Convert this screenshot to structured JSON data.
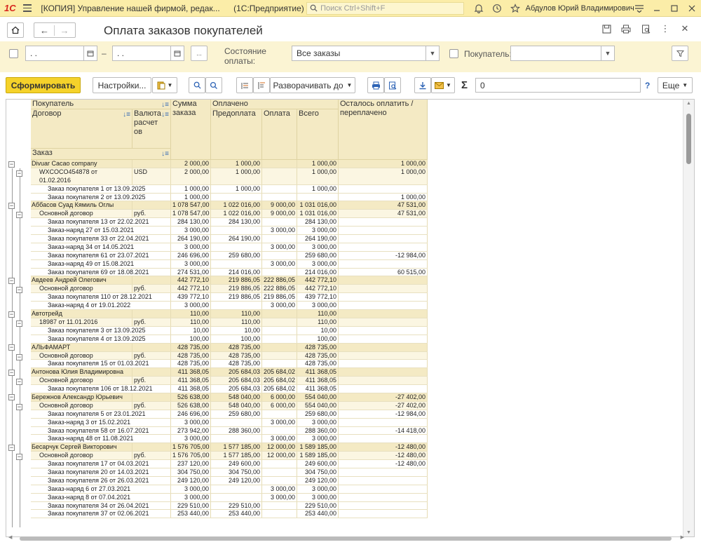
{
  "titlebar": {
    "logo": "1С",
    "app_title": "[КОПИЯ] Управление нашей фирмой, редак...",
    "platform": "(1С:Предприятие)",
    "search_placeholder": "Поиск Ctrl+Shift+F",
    "user": "Абдулов Юрий Владимирович"
  },
  "form": {
    "title": "Оплата заказов покупателей"
  },
  "filters": {
    "date_from": ". .",
    "date_to": ". .",
    "dash": "–",
    "period_btn": "...",
    "state_label": "Состояние оплаты:",
    "state_value": "Все заказы",
    "customer_label": "Покупатель:",
    "customer_value": ""
  },
  "commands": {
    "generate": "Сформировать",
    "settings": "Настройки...",
    "expand_to": "Разворачивать до",
    "sum_value": "0",
    "help": "?",
    "more": "Еще"
  },
  "table": {
    "headers": {
      "customer": "Покупатель",
      "contract": "Договор",
      "currency": "Валюта расчетов",
      "order": "Заказ",
      "order_sum": "Сумма заказа",
      "paid": "Оплачено",
      "prepay": "Предоплата",
      "payment": "Оплата",
      "total": "Всего",
      "remaining": "Осталось оплатить / переплачено"
    },
    "rows": [
      {
        "level": 1,
        "name": "Divuar Cacao company",
        "cur": "",
        "sum": "2 000,00",
        "pre": "1 000,00",
        "pay": "",
        "tot": "1 000,00",
        "rem": "1 000,00"
      },
      {
        "level": 2,
        "name": "WXCOCO454878 от 01.02.2016",
        "cur": "USD",
        "sum": "2 000,00",
        "pre": "1 000,00",
        "pay": "",
        "tot": "1 000,00",
        "rem": "1 000,00",
        "tall": true
      },
      {
        "level": 3,
        "name": "Заказ покупателя 1 от 13.09.2025",
        "cur": "",
        "sum": "1 000,00",
        "pre": "1 000,00",
        "pay": "",
        "tot": "1 000,00",
        "rem": ""
      },
      {
        "level": 3,
        "name": "Заказ покупателя 2 от 13.09.2025",
        "cur": "",
        "sum": "1 000,00",
        "pre": "",
        "pay": "",
        "tot": "",
        "rem": "1 000,00"
      },
      {
        "level": 1,
        "name": "Аббасов Суад Кямиль Оглы",
        "cur": "",
        "sum": "1 078 547,00",
        "pre": "1 022 016,00",
        "pay": "9 000,00",
        "tot": "1 031 016,00",
        "rem": "47 531,00"
      },
      {
        "level": 2,
        "name": "Основной договор",
        "cur": "руб.",
        "sum": "1 078 547,00",
        "pre": "1 022 016,00",
        "pay": "9 000,00",
        "tot": "1 031 016,00",
        "rem": "47 531,00"
      },
      {
        "level": 3,
        "name": "Заказ покупателя 13 от 22.02.2021",
        "cur": "",
        "sum": "284 130,00",
        "pre": "284 130,00",
        "pay": "",
        "tot": "284 130,00",
        "rem": ""
      },
      {
        "level": 3,
        "name": "Заказ-наряд 27 от 15.03.2021",
        "cur": "",
        "sum": "3 000,00",
        "pre": "",
        "pay": "3 000,00",
        "tot": "3 000,00",
        "rem": ""
      },
      {
        "level": 3,
        "name": "Заказ покупателя 33 от 22.04.2021",
        "cur": "",
        "sum": "264 190,00",
        "pre": "264 190,00",
        "pay": "",
        "tot": "264 190,00",
        "rem": ""
      },
      {
        "level": 3,
        "name": "Заказ-наряд 34 от 14.05.2021",
        "cur": "",
        "sum": "3 000,00",
        "pre": "",
        "pay": "3 000,00",
        "tot": "3 000,00",
        "rem": ""
      },
      {
        "level": 3,
        "name": "Заказ покупателя 61 от 23.07.2021",
        "cur": "",
        "sum": "246 696,00",
        "pre": "259 680,00",
        "pay": "",
        "tot": "259 680,00",
        "rem": "-12 984,00"
      },
      {
        "level": 3,
        "name": "Заказ-наряд 49 от 15.08.2021",
        "cur": "",
        "sum": "3 000,00",
        "pre": "",
        "pay": "3 000,00",
        "tot": "3 000,00",
        "rem": ""
      },
      {
        "level": 3,
        "name": "Заказ покупателя 69 от 18.08.2021",
        "cur": "",
        "sum": "274 531,00",
        "pre": "214 016,00",
        "pay": "",
        "tot": "214 016,00",
        "rem": "60 515,00"
      },
      {
        "level": 1,
        "name": "Авдеев Андрей Олегович",
        "cur": "",
        "sum": "442 772,10",
        "pre": "219 886,05",
        "pay": "222 886,05",
        "tot": "442 772,10",
        "rem": ""
      },
      {
        "level": 2,
        "name": "Основной договор",
        "cur": "руб.",
        "sum": "442 772,10",
        "pre": "219 886,05",
        "pay": "222 886,05",
        "tot": "442 772,10",
        "rem": ""
      },
      {
        "level": 3,
        "name": "Заказ покупателя 110 от 28.12.2021",
        "cur": "",
        "sum": "439 772,10",
        "pre": "219 886,05",
        "pay": "219 886,05",
        "tot": "439 772,10",
        "rem": ""
      },
      {
        "level": 3,
        "name": "Заказ-наряд 4 от 19.01.2022",
        "cur": "",
        "sum": "3 000,00",
        "pre": "",
        "pay": "3 000,00",
        "tot": "3 000,00",
        "rem": ""
      },
      {
        "level": 1,
        "name": "Автотрейд",
        "cur": "",
        "sum": "110,00",
        "pre": "110,00",
        "pay": "",
        "tot": "110,00",
        "rem": ""
      },
      {
        "level": 2,
        "name": "18987 от 11.01.2016",
        "cur": "руб.",
        "sum": "110,00",
        "pre": "110,00",
        "pay": "",
        "tot": "110,00",
        "rem": ""
      },
      {
        "level": 3,
        "name": "Заказ покупателя 3 от 13.09.2025",
        "cur": "",
        "sum": "10,00",
        "pre": "10,00",
        "pay": "",
        "tot": "10,00",
        "rem": ""
      },
      {
        "level": 3,
        "name": "Заказ покупателя 4 от 13.09.2025",
        "cur": "",
        "sum": "100,00",
        "pre": "100,00",
        "pay": "",
        "tot": "100,00",
        "rem": ""
      },
      {
        "level": 1,
        "name": "АЛЬФАМАРТ",
        "cur": "",
        "sum": "428 735,00",
        "pre": "428 735,00",
        "pay": "",
        "tot": "428 735,00",
        "rem": ""
      },
      {
        "level": 2,
        "name": "Основной договор",
        "cur": "руб.",
        "sum": "428 735,00",
        "pre": "428 735,00",
        "pay": "",
        "tot": "428 735,00",
        "rem": ""
      },
      {
        "level": 3,
        "name": "Заказ покупателя 15 от 01.03.2021",
        "cur": "",
        "sum": "428 735,00",
        "pre": "428 735,00",
        "pay": "",
        "tot": "428 735,00",
        "rem": ""
      },
      {
        "level": 1,
        "name": "Антонова Юлия Владимировна",
        "cur": "",
        "sum": "411 368,05",
        "pre": "205 684,03",
        "pay": "205 684,02",
        "tot": "411 368,05",
        "rem": ""
      },
      {
        "level": 2,
        "name": "Основной договор",
        "cur": "руб.",
        "sum": "411 368,05",
        "pre": "205 684,03",
        "pay": "205 684,02",
        "tot": "411 368,05",
        "rem": ""
      },
      {
        "level": 3,
        "name": "Заказ покупателя 106 от 18.12.2021",
        "cur": "",
        "sum": "411 368,05",
        "pre": "205 684,03",
        "pay": "205 684,02",
        "tot": "411 368,05",
        "rem": ""
      },
      {
        "level": 1,
        "name": "Бережнов Александр Юрьевич",
        "cur": "",
        "sum": "526 638,00",
        "pre": "548 040,00",
        "pay": "6 000,00",
        "tot": "554 040,00",
        "rem": "-27 402,00"
      },
      {
        "level": 2,
        "name": "Основной договор",
        "cur": "руб.",
        "sum": "526 638,00",
        "pre": "548 040,00",
        "pay": "6 000,00",
        "tot": "554 040,00",
        "rem": "-27 402,00"
      },
      {
        "level": 3,
        "name": "Заказ покупателя 5 от 23.01.2021",
        "cur": "",
        "sum": "246 696,00",
        "pre": "259 680,00",
        "pay": "",
        "tot": "259 680,00",
        "rem": "-12 984,00"
      },
      {
        "level": 3,
        "name": "Заказ-наряд 3 от 15.02.2021",
        "cur": "",
        "sum": "3 000,00",
        "pre": "",
        "pay": "3 000,00",
        "tot": "3 000,00",
        "rem": ""
      },
      {
        "level": 3,
        "name": "Заказ покупателя 58 от 16.07.2021",
        "cur": "",
        "sum": "273 942,00",
        "pre": "288 360,00",
        "pay": "",
        "tot": "288 360,00",
        "rem": "-14 418,00"
      },
      {
        "level": 3,
        "name": "Заказ-наряд 48 от 11.08.2021",
        "cur": "",
        "sum": "3 000,00",
        "pre": "",
        "pay": "3 000,00",
        "tot": "3 000,00",
        "rem": ""
      },
      {
        "level": 1,
        "name": "Бесарчук Сергей Викторович",
        "cur": "",
        "sum": "1 576 705,00",
        "pre": "1 577 185,00",
        "pay": "12 000,00",
        "tot": "1 589 185,00",
        "rem": "-12 480,00"
      },
      {
        "level": 2,
        "name": "Основной договор",
        "cur": "руб.",
        "sum": "1 576 705,00",
        "pre": "1 577 185,00",
        "pay": "12 000,00",
        "tot": "1 589 185,00",
        "rem": "-12 480,00"
      },
      {
        "level": 3,
        "name": "Заказ покупателя 17 от 04.03.2021",
        "cur": "",
        "sum": "237 120,00",
        "pre": "249 600,00",
        "pay": "",
        "tot": "249 600,00",
        "rem": "-12 480,00"
      },
      {
        "level": 3,
        "name": "Заказ покупателя 20 от 14.03.2021",
        "cur": "",
        "sum": "304 750,00",
        "pre": "304 750,00",
        "pay": "",
        "tot": "304 750,00",
        "rem": ""
      },
      {
        "level": 3,
        "name": "Заказ покупателя 26 от 26.03.2021",
        "cur": "",
        "sum": "249 120,00",
        "pre": "249 120,00",
        "pay": "",
        "tot": "249 120,00",
        "rem": ""
      },
      {
        "level": 3,
        "name": "Заказ-наряд 6 от 27.03.2021",
        "cur": "",
        "sum": "3 000,00",
        "pre": "",
        "pay": "3 000,00",
        "tot": "3 000,00",
        "rem": ""
      },
      {
        "level": 3,
        "name": "Заказ-наряд 8 от 07.04.2021",
        "cur": "",
        "sum": "3 000,00",
        "pre": "",
        "pay": "3 000,00",
        "tot": "3 000,00",
        "rem": ""
      },
      {
        "level": 3,
        "name": "Заказ покупателя 34 от 26.04.2021",
        "cur": "",
        "sum": "229 510,00",
        "pre": "229 510,00",
        "pay": "",
        "tot": "229 510,00",
        "rem": ""
      },
      {
        "level": 3,
        "name": "Заказ покупателя 37 от 02.06.2021",
        "cur": "",
        "sum": "253 440,00",
        "pre": "253 440,00",
        "pay": "",
        "tot": "253 440,00",
        "rem": ""
      }
    ]
  }
}
